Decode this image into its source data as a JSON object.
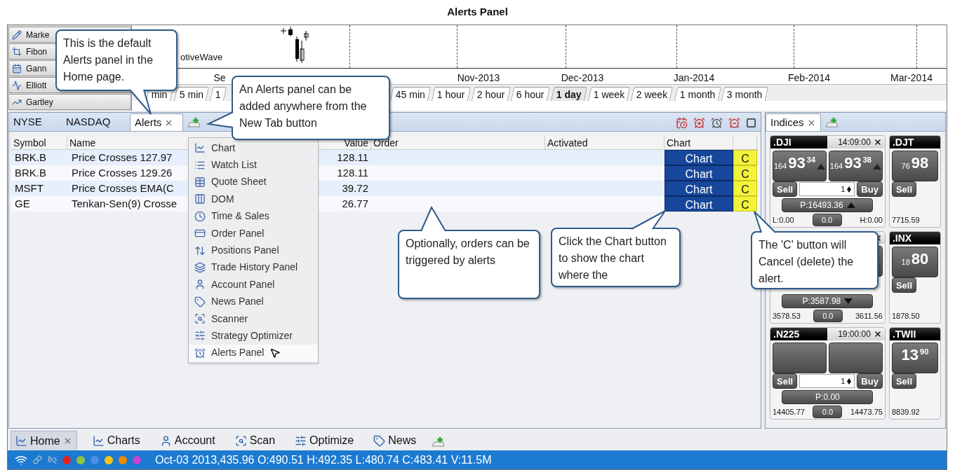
{
  "title": "Alerts Panel",
  "drawing_tools": [
    {
      "label": "Marke"
    },
    {
      "label": "Fibon"
    },
    {
      "label": "Gann"
    },
    {
      "label": "Elliott"
    },
    {
      "label": "Gartley"
    }
  ],
  "chart": {
    "watermark": "otiveWave",
    "x_axis_labels": [
      "Se",
      "Nov-2013",
      "Dec-2013",
      "Jan-2014",
      "Feb-2014",
      "Mar-2014"
    ]
  },
  "timeframes_left": [
    {
      "label": "min",
      "selected": false
    },
    {
      "label": "5 min",
      "selected": false
    },
    {
      "label": "1",
      "selected": false
    }
  ],
  "timeframes_right": [
    {
      "label": "45 min",
      "selected": false
    },
    {
      "label": "1 hour",
      "selected": false
    },
    {
      "label": "2 hour",
      "selected": false
    },
    {
      "label": "6 hour",
      "selected": false
    },
    {
      "label": "1 day",
      "selected": true
    },
    {
      "label": "1 week",
      "selected": false
    },
    {
      "label": "2 week",
      "selected": false
    },
    {
      "label": "1 month",
      "selected": false
    },
    {
      "label": "3 month",
      "selected": false
    }
  ],
  "alerts_panel": {
    "tabs": [
      {
        "label": "NYSE",
        "selected": false,
        "closable": false
      },
      {
        "label": "NASDAQ",
        "selected": false,
        "closable": false
      },
      {
        "label": "Alerts",
        "selected": true,
        "closable": true
      }
    ],
    "columns": [
      "Symbol",
      "Name",
      "Value",
      "Order",
      "Activated",
      "Chart"
    ],
    "rows": [
      {
        "symbol": "BRK.B",
        "name": "Price Crosses 127.97",
        "value": "128.11",
        "chart_button": "Chart",
        "cancel_button": "C"
      },
      {
        "symbol": "BRK.B",
        "name": "Price Crosses 129.26",
        "value": "128.11",
        "chart_button": "Chart",
        "cancel_button": "C"
      },
      {
        "symbol": "MSFT",
        "name": "Price Crosses EMA(C",
        "value": "39.72",
        "chart_button": "Chart",
        "cancel_button": "C"
      },
      {
        "symbol": "GE",
        "name": "Tenkan-Sen(9) Crosse",
        "value": "26.77",
        "chart_button": "Chart",
        "cancel_button": "C"
      }
    ]
  },
  "new_tab_menu": [
    {
      "label": "Chart",
      "selected": false
    },
    {
      "label": "Watch List",
      "selected": false
    },
    {
      "label": "Quote Sheet",
      "selected": false
    },
    {
      "label": "DOM",
      "selected": false
    },
    {
      "label": "Time & Sales",
      "selected": false
    },
    {
      "label": "Order Panel",
      "selected": false
    },
    {
      "label": "Positions Panel",
      "selected": false
    },
    {
      "label": "Trade History Panel",
      "selected": false
    },
    {
      "label": "Account Panel",
      "selected": false
    },
    {
      "label": "News Panel",
      "selected": false
    },
    {
      "label": "Scanner",
      "selected": false
    },
    {
      "label": "Strategy Optimizer",
      "selected": false
    },
    {
      "label": "Alerts Panel",
      "selected": true
    }
  ],
  "indices_panel": {
    "tab": {
      "label": "Indices",
      "closable": true
    },
    "card_columns": [
      [
        {
          "symbol": ".DJI",
          "time": "14:09:00",
          "closable": true,
          "sell": {
            "small": "164",
            "big": "93",
            "sup": "34"
          },
          "buy": {
            "small": "164",
            "big": "93",
            "sup": "38"
          },
          "sell_label": "Sell",
          "buy_label": "Buy",
          "quantity": "1",
          "price": "P:16493.36",
          "rising": true,
          "low": "L:0.00",
          "change": "0.0",
          "high": "H:0.00"
        },
        {
          "closable": true,
          "price": "P:3587.98",
          "rising": false,
          "low": "3578.53",
          "change": "0.0",
          "high": "3611.56"
        },
        {
          "symbol": ".N225",
          "time": "19:00:00",
          "closable": true,
          "sell_label": "Sell",
          "buy_label": "Buy",
          "quantity": "1",
          "price": "P:0.00",
          "low": "14405.77",
          "change": "0.0",
          "high": "14473.75"
        }
      ],
      [
        {
          "symbol": ".DJT",
          "sell": {
            "small": "76",
            "big": "98"
          },
          "sell_label": "Sell",
          "low": "7715.59"
        },
        {
          "symbol": ".INX",
          "sell": {
            "small": "18",
            "big": "80"
          },
          "sell_label": "Sell",
          "low": "1878.50"
        },
        {
          "symbol": ".TWII",
          "sell": {
            "big": "13",
            "sup": "90"
          },
          "sell_label": "Sell",
          "low": "8839.92"
        }
      ]
    ]
  },
  "bottom_tabs": [
    {
      "label": "Home",
      "selected": true,
      "closable": true
    },
    {
      "label": "Charts",
      "selected": false,
      "closable": false
    },
    {
      "label": "Account",
      "selected": false,
      "closable": false
    },
    {
      "label": "Scan",
      "selected": false,
      "closable": false
    },
    {
      "label": "Optimize",
      "selected": false,
      "closable": false
    },
    {
      "label": "News",
      "selected": false,
      "closable": false
    }
  ],
  "status_bar": {
    "indicators": [
      {
        "color": "#e02424"
      },
      {
        "color": "#8cc63f"
      },
      {
        "color": "#4a90e2"
      },
      {
        "color": "#f5c518"
      },
      {
        "color": "#f08a00"
      },
      {
        "color": "#c445d6"
      }
    ],
    "text": "Oct-03 2013,435.96 O:490.51 H:492.35 L:480.74 C:483.41 V:11.5M"
  },
  "callouts": [
    "This is the default Alerts panel in the Home page.",
    "An Alerts panel can be added anywhere from the New Tab button",
    "Optionally, orders can be triggered by alerts",
    "Click the Chart button to show the chart where the",
    "The 'C' button will Cancel (delete) the alert."
  ]
}
